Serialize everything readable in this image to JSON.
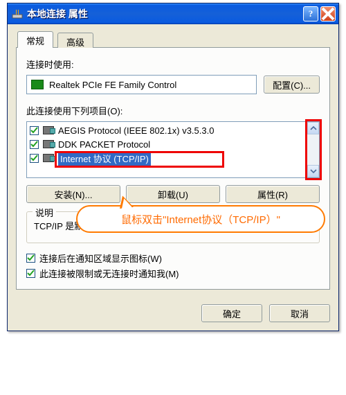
{
  "titlebar": {
    "title": "本地连接 属性"
  },
  "tabs": {
    "general": "常规",
    "advanced": "高级"
  },
  "labels": {
    "connect_using": "连接时使用:",
    "items_used": "此连接使用下列项目(O):",
    "description_legend": "说明"
  },
  "device": {
    "name": "Realtek PCIe FE Family Control"
  },
  "buttons": {
    "configure": "配置(C)...",
    "install": "安装(N)...",
    "uninstall": "卸载(U)",
    "properties": "属性(R)",
    "ok": "确定",
    "cancel": "取消"
  },
  "items": [
    {
      "label": "AEGIS Protocol (IEEE 802.1x) v3.5.3.0",
      "checked": true
    },
    {
      "label": "DDK PACKET Protocol",
      "checked": true
    },
    {
      "label": "Internet 协议 (TCP/IP)",
      "checked": true,
      "selected": true
    }
  ],
  "desc_text": "TCP/IP 是默认的广域网协议。它提供跨越多种互联网络的通讯。",
  "checks": {
    "show_icon": "连接后在通知区域显示图标(W)",
    "notify": "此连接被限制或无连接时通知我(M)"
  },
  "callout": "鼠标双击\"Internet协议（TCP/IP）\""
}
